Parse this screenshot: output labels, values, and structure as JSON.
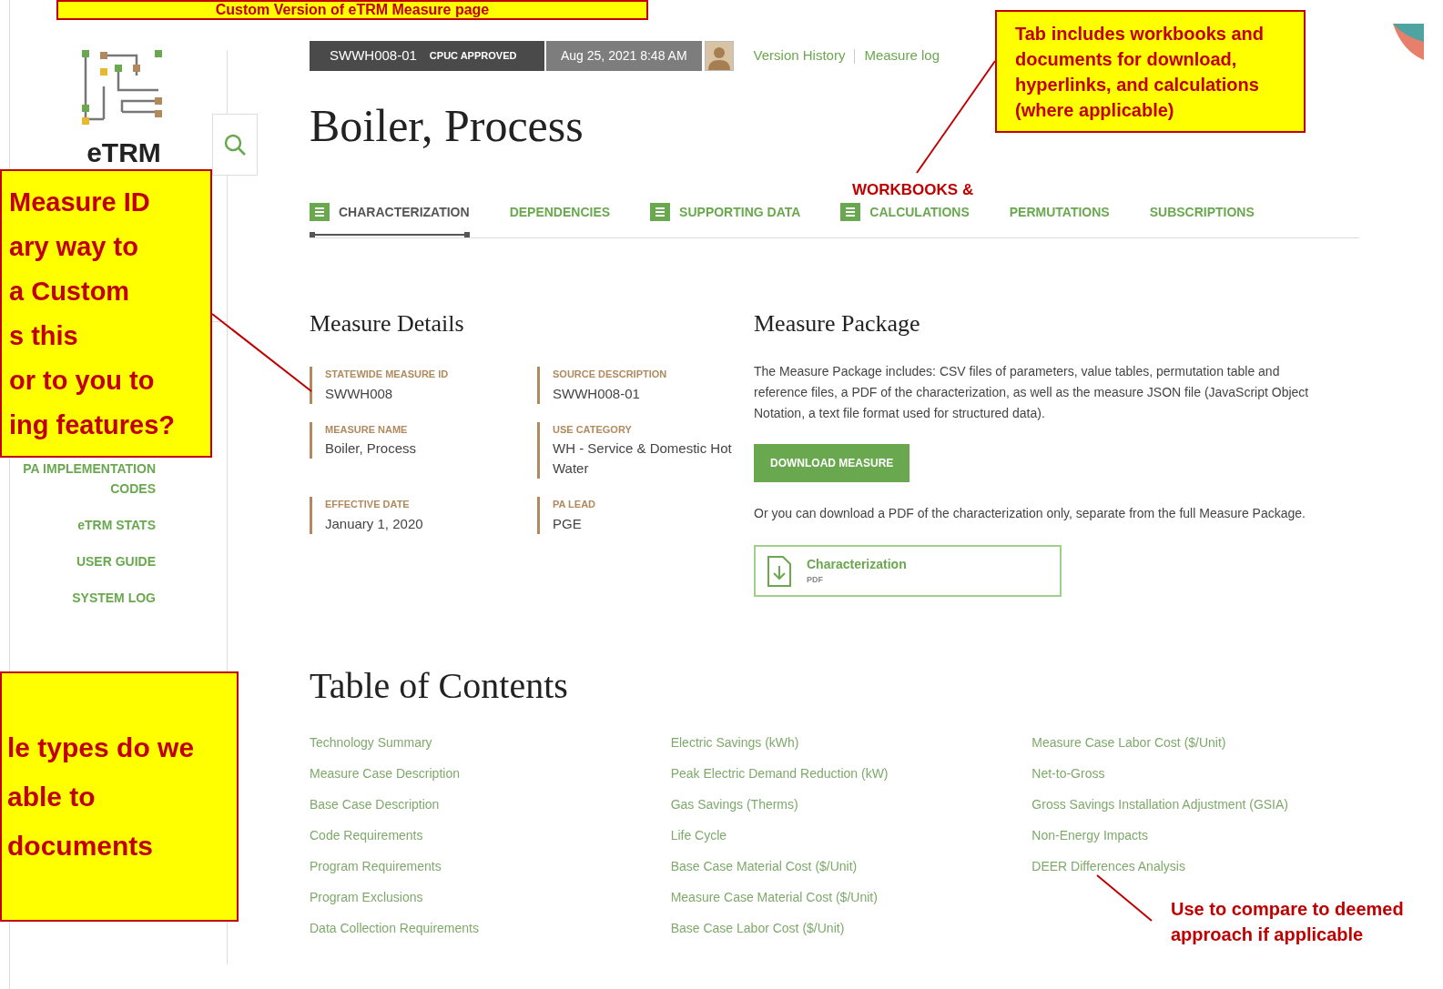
{
  "title_callout": {
    "text": "Custom Version of eTRM Measure page"
  },
  "callouts": [
    {
      "lines": [
        "Measure ID",
        "ary way to",
        "a Custom",
        "s this",
        "or to you to",
        "ing features?"
      ]
    },
    {
      "lines": [
        "Tab includes workbooks and",
        "documents for download,",
        "hyperlinks, and calculations",
        "(where applicable)"
      ]
    },
    {
      "lines": [
        "le types do we",
        "able to",
        "documents"
      ]
    }
  ],
  "tab_note": "WORKBOOKS &",
  "footnote": {
    "lines": [
      "Use to compare to deemed",
      "approach if applicable"
    ]
  },
  "sidebar": {
    "logo_text": "eTRM",
    "items": [
      {
        "label": "PA IMPLEMENTATION CODES"
      },
      {
        "label": "eTRM STATS"
      },
      {
        "label": "USER GUIDE"
      },
      {
        "label": "SYSTEM LOG"
      }
    ]
  },
  "header": {
    "measure_code": "SWWH008-01",
    "status": "CPUC APPROVED",
    "date": "Aug 25, 2021 8:48 AM",
    "links": [
      "Version History",
      "Measure log"
    ]
  },
  "title": "Boiler, Process",
  "tabs": [
    {
      "label": "CHARACTERIZATION",
      "has_icon": true,
      "selected": true
    },
    {
      "label": "DEPENDENCIES",
      "has_icon": false,
      "selected": false
    },
    {
      "label": "SUPPORTING DATA",
      "has_icon": true,
      "selected": false
    },
    {
      "label": "CALCULATIONS",
      "has_icon": true,
      "selected": false
    },
    {
      "label": "PERMUTATIONS",
      "has_icon": false,
      "selected": false
    },
    {
      "label": "SUBSCRIPTIONS",
      "has_icon": false,
      "selected": false
    }
  ],
  "measure_details": {
    "heading": "Measure Details",
    "fields": [
      {
        "label": "STATEWIDE MEASURE ID",
        "value": "SWWH008"
      },
      {
        "label": "SOURCE DESCRIPTION",
        "value": "SWWH008-01"
      },
      {
        "label": "MEASURE NAME",
        "value": "Boiler, Process"
      },
      {
        "label": "USE CATEGORY",
        "value": "WH - Service & Domestic Hot Water"
      },
      {
        "label": "EFFECTIVE DATE",
        "value": "January 1, 2020"
      },
      {
        "label": "PA LEAD",
        "value": "PGE"
      }
    ]
  },
  "measure_package": {
    "heading": "Measure Package",
    "description": "The Measure Package includes: CSV files of parameters, value tables, permutation table and reference files, a PDF of the characterization, as well as the measure JSON file (JavaScript Object Notation, a text file format used for structured data).",
    "button": "DOWNLOAD MEASURE",
    "note": "Or you can download a PDF of the characterization only, separate from the full Measure Package.",
    "file": {
      "name": "Characterization",
      "type": "PDF"
    }
  },
  "table_of_contents": {
    "heading": "Table of Contents",
    "columns": [
      [
        "Technology Summary",
        "Measure Case Description",
        "Base Case Description",
        "Code Requirements",
        "Program Requirements",
        "Program Exclusions",
        "Data Collection Requirements"
      ],
      [
        "Electric Savings (kWh)",
        "Peak Electric Demand Reduction (kW)",
        "Gas Savings (Therms)",
        "Life Cycle",
        "Base Case Material Cost ($/Unit)",
        "Measure Case Material Cost ($/Unit)",
        "Base Case Labor Cost ($/Unit)"
      ],
      [
        "Measure Case Labor Cost ($/Unit)",
        "Net-to-Gross",
        "Gross Savings Installation Adjustment (GSIA)",
        "Non-Energy Impacts",
        "DEER Differences Analysis"
      ]
    ]
  }
}
